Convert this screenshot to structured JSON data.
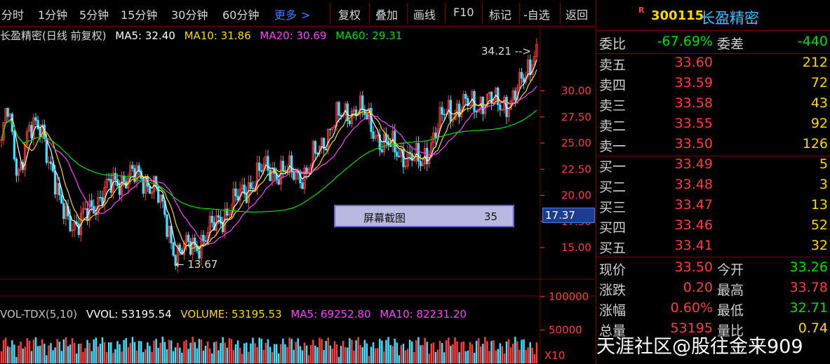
{
  "toolbar": {
    "periods": [
      "分时",
      "1分钟",
      "5分钟",
      "15分钟",
      "30分钟",
      "60分钟"
    ],
    "more": "更多",
    "buttons": [
      "复权",
      "叠加",
      "画线",
      "F10",
      "标记",
      "-自选",
      "返回"
    ]
  },
  "chart": {
    "title": "长盈精密(日线 前复权)",
    "ma": [
      {
        "label": "MA5: 32.40",
        "color": "#ffffff"
      },
      {
        "label": "MA10: 31.86",
        "color": "#ffd700"
      },
      {
        "label": "MA20: 30.69",
        "color": "#ff40ff"
      },
      {
        "label": "MA60: 29.31",
        "color": "#00e000"
      }
    ],
    "y_ticks": [
      "30.00",
      "27.50",
      "25.00",
      "22.50",
      "20.00",
      "17.50",
      "15.00"
    ],
    "high_label": "34.21",
    "low_label": "13.67",
    "price_tag": "17.37",
    "screenshot_label": "屏幕截图",
    "screenshot_num": "35",
    "colors": {
      "up": "#ff3c3c",
      "down": "#40e0ff",
      "grid": "#7a0000"
    }
  },
  "volume": {
    "legend": [
      {
        "label": "VOL-TDX(5,10)",
        "color": "#c0c0c0"
      },
      {
        "label": "VVOL: 53195.54",
        "color": "#ffffff"
      },
      {
        "label": "VOLUME: 53195.53",
        "color": "#ffd700"
      },
      {
        "label": "MA5: 69252.80",
        "color": "#ff40ff"
      },
      {
        "label": "MA10: 82231.20",
        "color": "#ff40ff"
      }
    ],
    "y_ticks": [
      "100000",
      "50000"
    ],
    "scale": "X10"
  },
  "quote": {
    "code": "300115",
    "name": "长盈精密",
    "r_mark": "R",
    "weibi": {
      "label": "委比",
      "value": "-67.69%",
      "label2": "委差",
      "value2": "-440"
    },
    "sell": [
      {
        "label": "卖五",
        "price": "33.60",
        "vol": "212"
      },
      {
        "label": "卖四",
        "price": "33.59",
        "vol": "72"
      },
      {
        "label": "卖三",
        "price": "33.58",
        "vol": "43"
      },
      {
        "label": "卖二",
        "price": "33.55",
        "vol": "92"
      },
      {
        "label": "卖一",
        "price": "33.50",
        "vol": "126"
      }
    ],
    "buy": [
      {
        "label": "买一",
        "price": "33.49",
        "vol": "5"
      },
      {
        "label": "买二",
        "price": "33.48",
        "vol": "3"
      },
      {
        "label": "买三",
        "price": "33.47",
        "vol": "13"
      },
      {
        "label": "买四",
        "price": "33.46",
        "vol": "52"
      },
      {
        "label": "买五",
        "price": "33.41",
        "vol": "32"
      }
    ],
    "stats": [
      {
        "l1": "现价",
        "v1": "33.50",
        "l2": "今开",
        "v2": "33.26"
      },
      {
        "l1": "涨跌",
        "v1": "0.20",
        "l2": "最高",
        "v2": "33.78"
      },
      {
        "l1": "涨幅",
        "v1": "0.60%",
        "l2": "最低",
        "v2": "32.71"
      },
      {
        "l1": "总量",
        "v1": "53195",
        "l2": "量比",
        "v2": "0.74"
      }
    ]
  },
  "watermark": "天涯社区@股往金来909"
}
